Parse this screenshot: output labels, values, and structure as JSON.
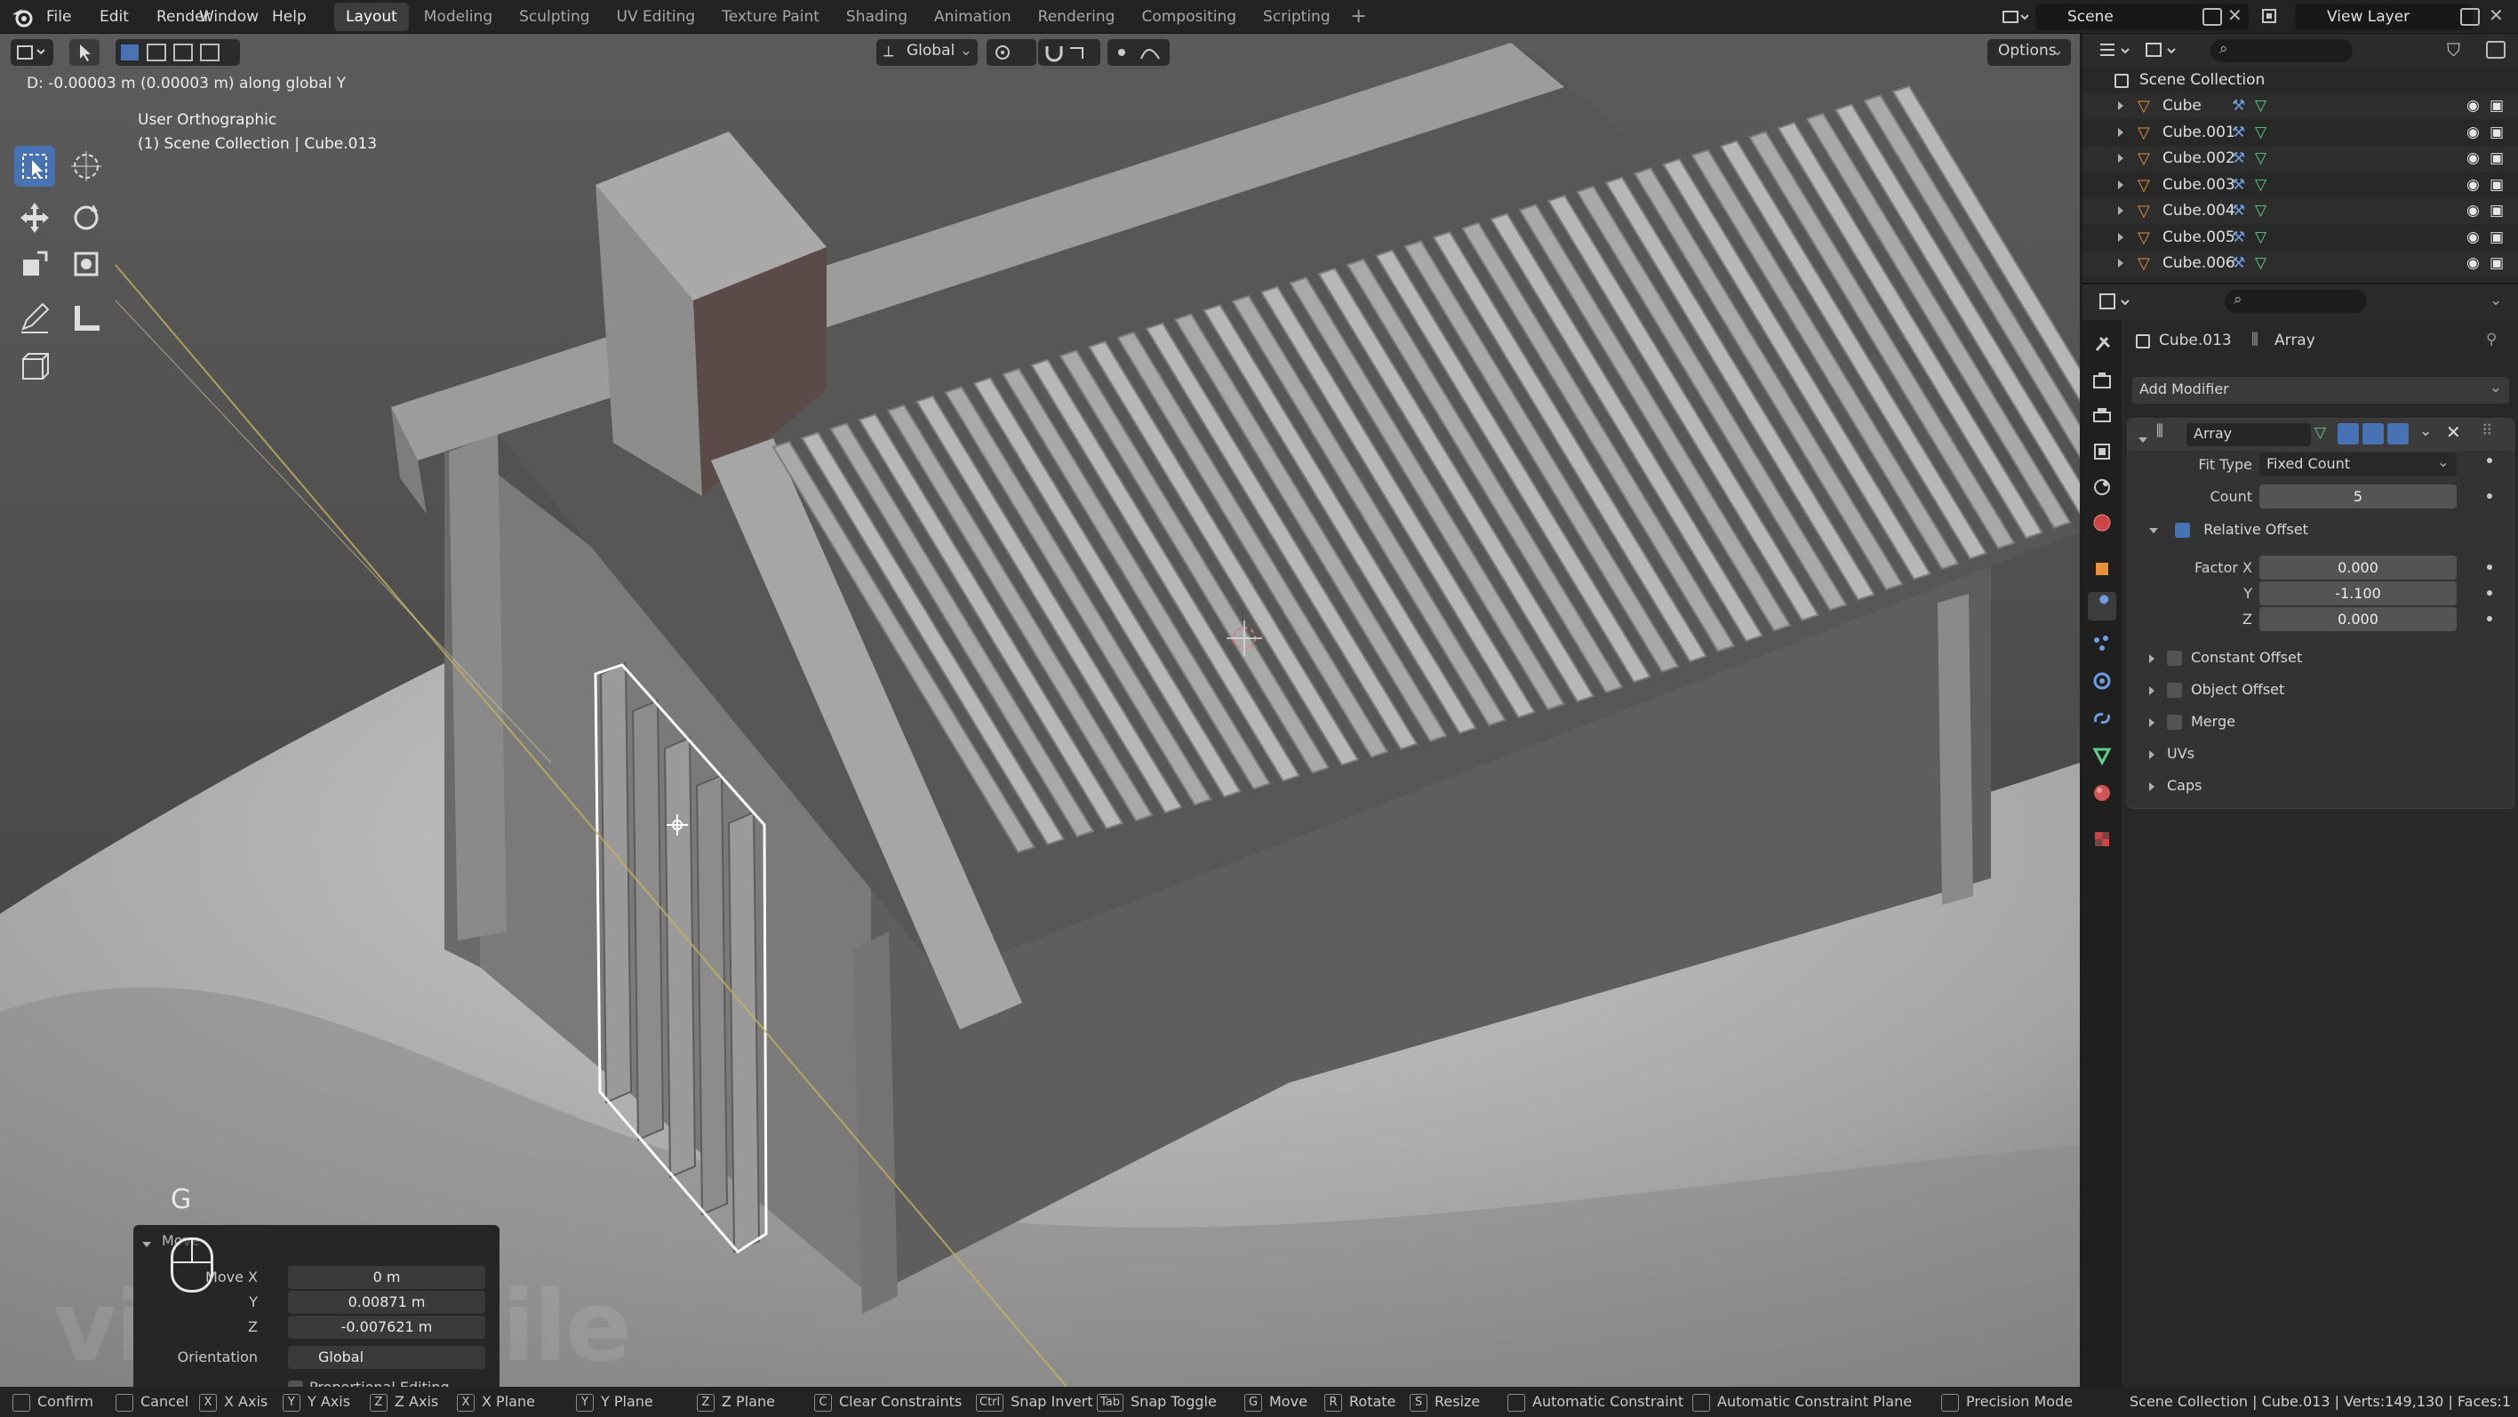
{
  "menu": [
    "File",
    "Edit",
    "Render",
    "Window",
    "Help"
  ],
  "workspaces": [
    "Layout",
    "Modeling",
    "Sculpting",
    "UV Editing",
    "Texture Paint",
    "Shading",
    "Animation",
    "Rendering",
    "Compositing",
    "Scripting"
  ],
  "active_workspace": "Layout",
  "scene_name": "Scene",
  "view_layer": "View Layer",
  "viewport": {
    "transform_orientation": "Global",
    "options_label": "Options",
    "status_text": "D: -0.00003 m (0.00003 m) along global Y",
    "view_name": "User Orthographic",
    "collection_path": "(1) Scene Collection | Cube.013",
    "key_hint": "G"
  },
  "operator_panel": {
    "title": "Move",
    "move_x_label": "Move X",
    "move_x": "0 m",
    "y_label": "Y",
    "y": "0.00871 m",
    "z_label": "Z",
    "z": "-0.007621 m",
    "orientation_label": "Orientation",
    "orientation": "Global",
    "proportional_editing": "Proportional Editing"
  },
  "watermark": "videosmile",
  "outliner": {
    "root": "Scene Collection",
    "items": [
      "Cube",
      "Cube.001",
      "Cube.002",
      "Cube.003",
      "Cube.004",
      "Cube.005",
      "Cube.006"
    ]
  },
  "properties": {
    "object_name": "Cube.013",
    "modifier_context": "Array",
    "add_modifier": "Add Modifier",
    "modifier_name": "Array",
    "fit_type_label": "Fit Type",
    "fit_type": "Fixed Count",
    "count_label": "Count",
    "count": "5",
    "relative_offset_label": "Relative Offset",
    "relative_offset_enabled": true,
    "factor_x_label": "Factor X",
    "factor_x": "0.000",
    "factor_y_label": "Y",
    "factor_y": "-1.100",
    "factor_z_label": "Z",
    "factor_z": "0.000",
    "subpanels": [
      "Constant Offset",
      "Object Offset",
      "Merge",
      "UVs",
      "Caps"
    ]
  },
  "statusbar": {
    "hints": [
      {
        "key": "",
        "label": "Confirm"
      },
      {
        "key": "",
        "label": "Cancel"
      },
      {
        "key": "X",
        "label": "X Axis"
      },
      {
        "key": "Y",
        "label": "Y Axis"
      },
      {
        "key": "Z",
        "label": "Z Axis"
      },
      {
        "key": "X",
        "label": "X Plane"
      },
      {
        "key": "Y",
        "label": "Y Plane"
      },
      {
        "key": "Z",
        "label": "Z Plane"
      },
      {
        "key": "C",
        "label": "Clear Constraints"
      },
      {
        "key": "Ctrl",
        "label": "Snap Invert"
      },
      {
        "key": "Tab",
        "label": "Snap Toggle"
      },
      {
        "key": "G",
        "label": "Move"
      },
      {
        "key": "R",
        "label": "Rotate"
      },
      {
        "key": "S",
        "label": "Resize"
      },
      {
        "key": "",
        "label": "Automatic Constraint"
      },
      {
        "key": "",
        "label": "Automatic Constraint Plane"
      },
      {
        "key": "",
        "label": "Precision Mode"
      }
    ],
    "stats": "Scene Collection | Cube.013 | Verts:149,130 | Faces:1"
  },
  "colors": {
    "accent": "#4772b3",
    "object_orange": "#e8903a",
    "mesh_green": "#5fcf8a",
    "modifier_blue": "#6e9ee0"
  }
}
